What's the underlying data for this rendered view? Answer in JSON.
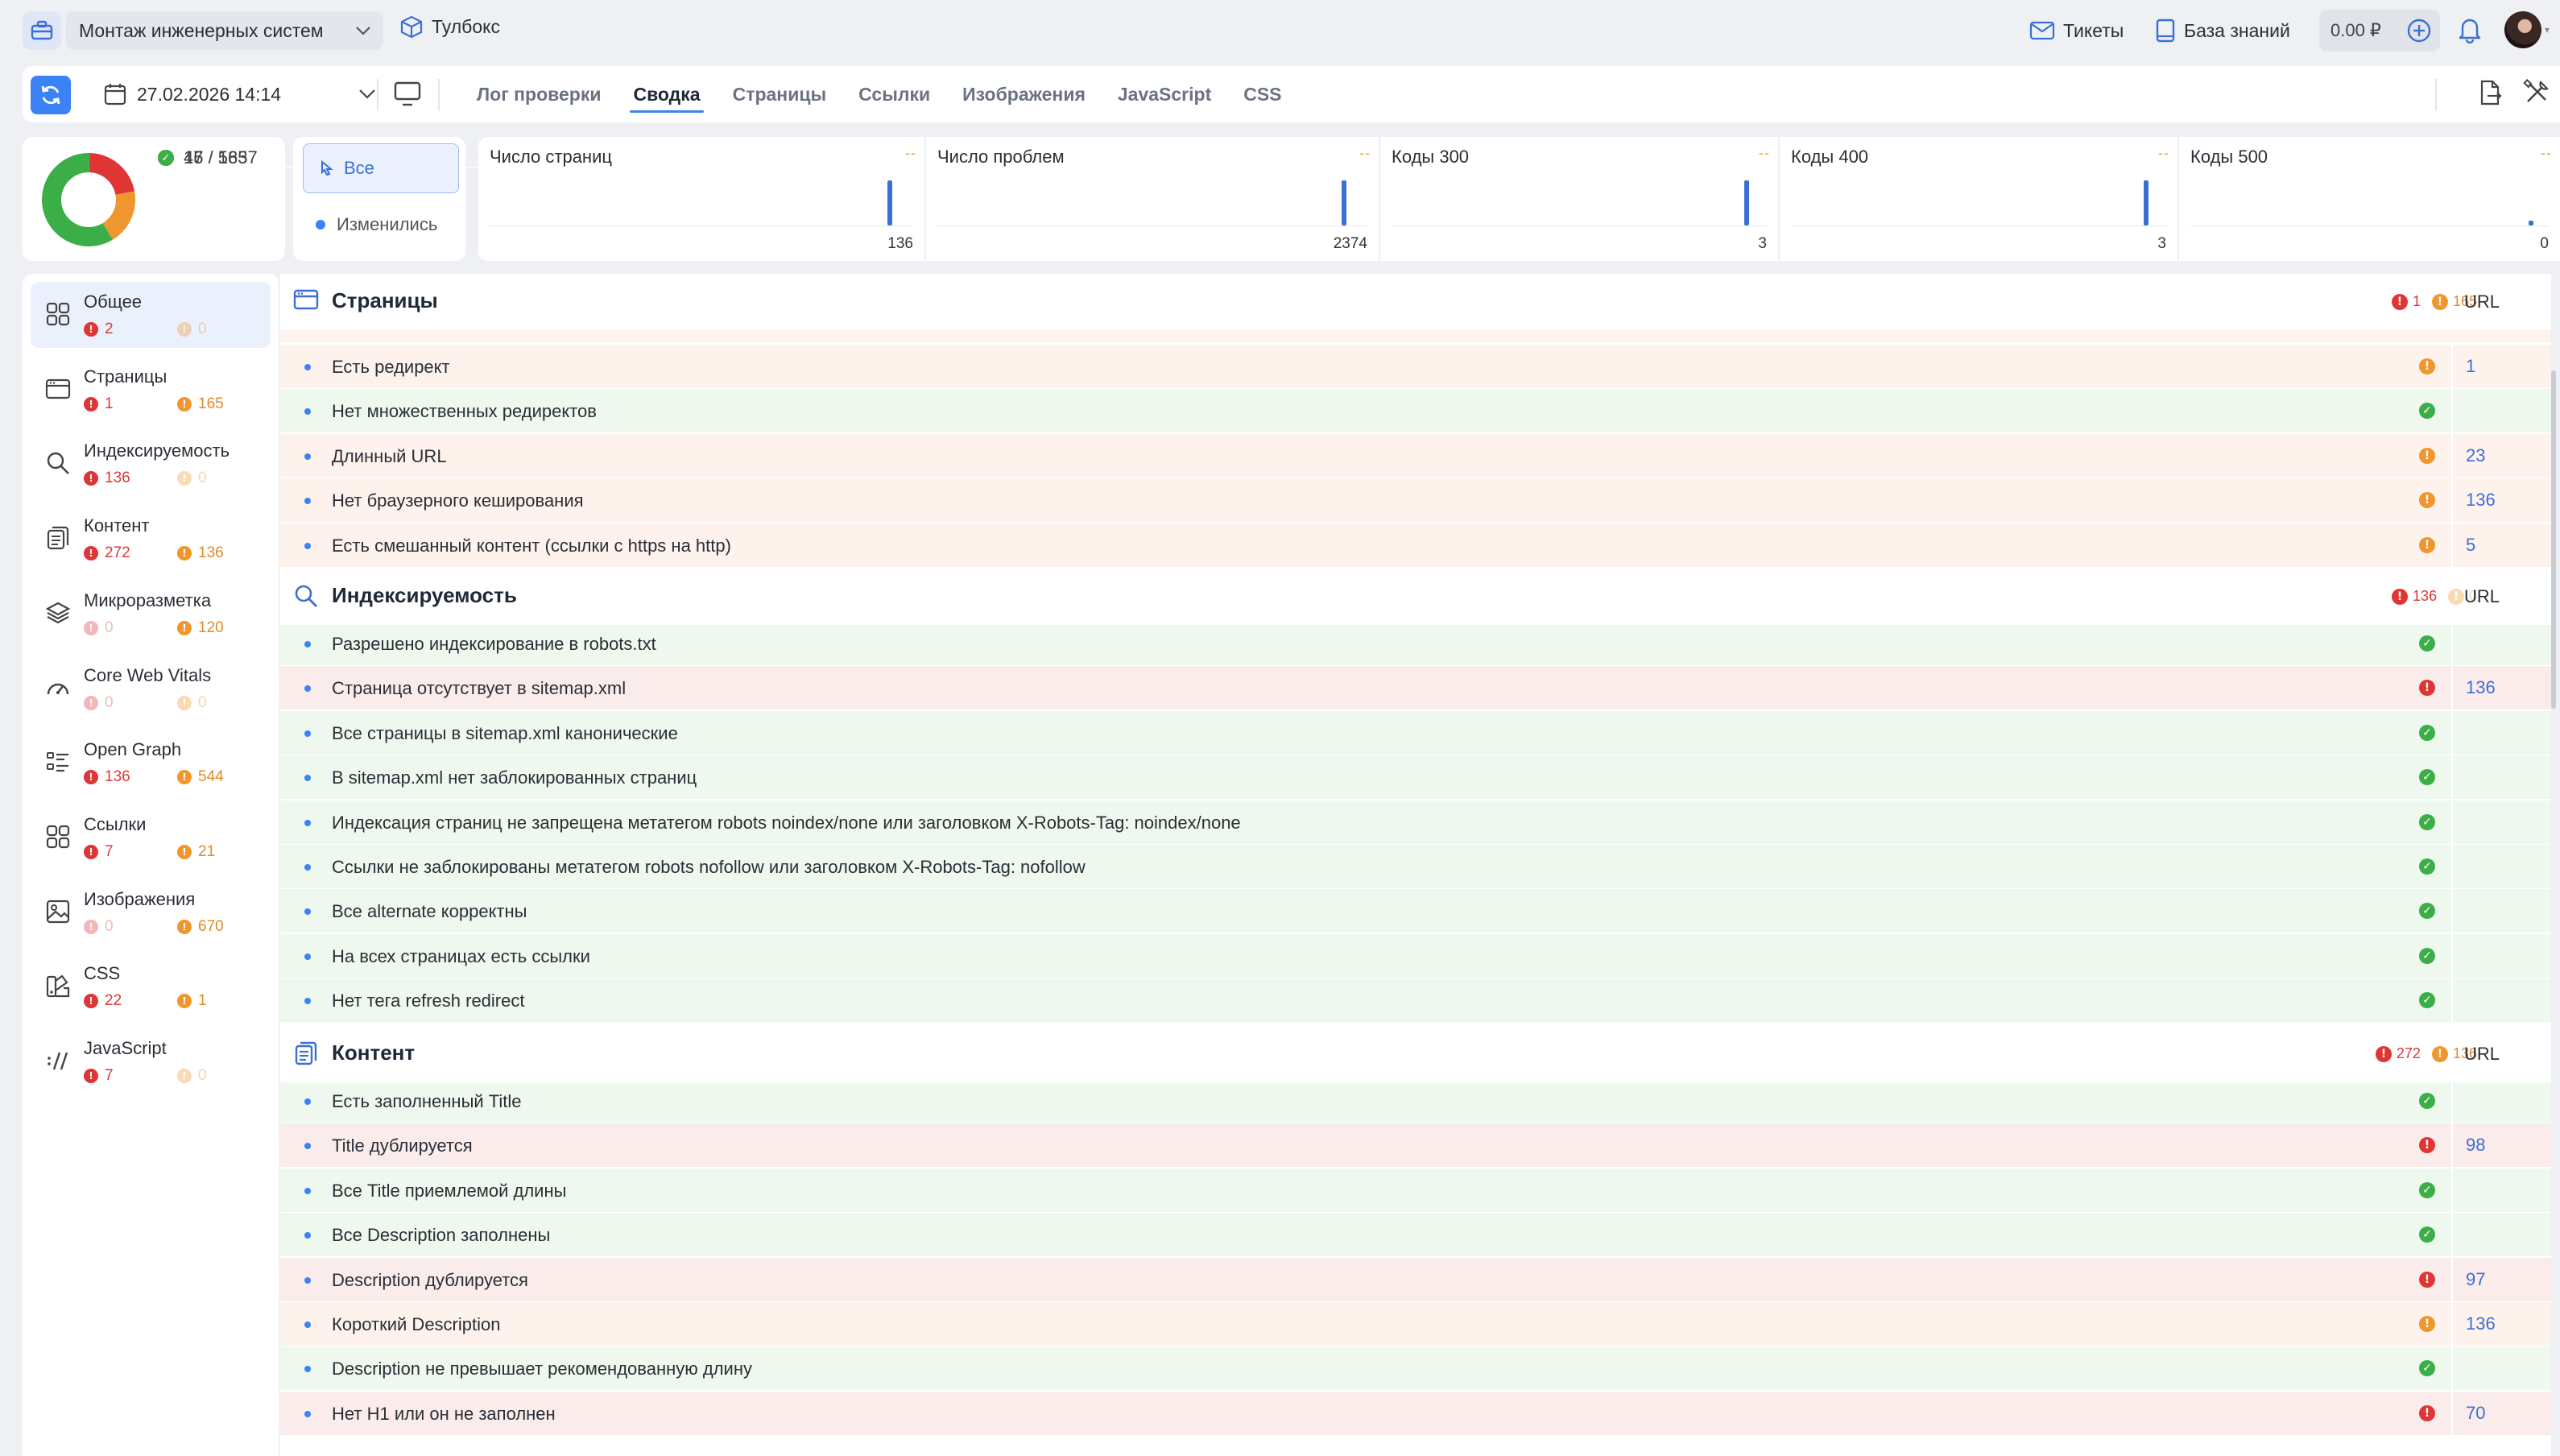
{
  "topbar": {
    "project": "Монтаж инженерных систем",
    "toolbox": "Тулбокс",
    "tickets": "Тикеты",
    "knowledge_base": "База знаний",
    "balance": "0.00 ₽"
  },
  "nav": {
    "date": "27.02.2026 14:14",
    "tabs": [
      "Лог проверки",
      "Сводка",
      "Страницы",
      "Ссылки",
      "Изображения",
      "JavaScript",
      "CSS"
    ],
    "active_tab": "Сводка"
  },
  "summary": {
    "errors": "17 / 583",
    "warnings": "15 / 1657",
    "passed": "46",
    "donut": {
      "errors": 17,
      "warnings": 15,
      "passed": 46,
      "colors": {
        "errors": "#e03535",
        "warnings": "#f0962e",
        "passed": "#3cae48"
      }
    }
  },
  "filter": {
    "all": "Все",
    "changed": "Изменились"
  },
  "metrics": [
    {
      "label": "Число страниц",
      "trend": "--",
      "value": "136"
    },
    {
      "label": "Число проблем",
      "trend": "--",
      "value": "2374"
    },
    {
      "label": "Коды 300",
      "trend": "--",
      "value": "3"
    },
    {
      "label": "Коды 400",
      "trend": "--",
      "value": "3"
    },
    {
      "label": "Коды 500",
      "trend": "--",
      "value": "0"
    }
  ],
  "sidebar": [
    {
      "label": "Общее",
      "err": "2",
      "warn": "0",
      "icon": "grid-icon",
      "active": true
    },
    {
      "label": "Страницы",
      "err": "1",
      "warn": "165",
      "icon": "browser-window-icon"
    },
    {
      "label": "Индексируемость",
      "err": "136",
      "warn": "0",
      "icon": "search-icon"
    },
    {
      "label": "Контент",
      "err": "272",
      "warn": "136",
      "icon": "documents-icon"
    },
    {
      "label": "Микроразметка",
      "err": "0",
      "warn": "120",
      "icon": "layers-icon"
    },
    {
      "label": "Core Web Vitals",
      "err": "0",
      "warn": "0",
      "icon": "gauge-icon"
    },
    {
      "label": "Open Graph",
      "err": "136",
      "warn": "544",
      "icon": "list-icon"
    },
    {
      "label": "Ссылки",
      "err": "7",
      "warn": "21",
      "icon": "grid-icon"
    },
    {
      "label": "Изображения",
      "err": "0",
      "warn": "670",
      "icon": "image-icon"
    },
    {
      "label": "CSS",
      "err": "22",
      "warn": "1",
      "icon": "css-swatch-icon"
    },
    {
      "label": "JavaScript",
      "err": "7",
      "warn": "0",
      "icon": "js-slash-icon"
    }
  ],
  "sections": [
    {
      "title": "Страницы",
      "err": "1",
      "warn": "165",
      "url_label": "URL",
      "rows": [
        {
          "text": "Есть редирект",
          "status": "warn",
          "url": "1"
        },
        {
          "text": "Нет множественных редиректов",
          "status": "ok",
          "url": ""
        },
        {
          "text": "Длинный URL",
          "status": "warn",
          "url": "23"
        },
        {
          "text": "Нет браузерного кеширования",
          "status": "warn",
          "url": "136"
        },
        {
          "text": "Есть смешанный контент (ссылки с https на http)",
          "status": "warn",
          "url": "5"
        }
      ]
    },
    {
      "title": "Индексируемость",
      "err": "136",
      "warn": "0",
      "url_label": "URL",
      "rows": [
        {
          "text": "Разрешено индексирование в robots.txt",
          "status": "ok",
          "url": ""
        },
        {
          "text": "Страница отсутствует в sitemap.xml",
          "status": "err",
          "url": "136"
        },
        {
          "text": "Все страницы в sitemap.xml канонические",
          "status": "ok",
          "url": ""
        },
        {
          "text": "В sitemap.xml нет заблокированных страниц",
          "status": "ok",
          "url": ""
        },
        {
          "text": "Индексация страниц не запрещена метатегом robots noindex/none или заголовком X-Robots-Tag: noindex/none",
          "status": "ok",
          "url": ""
        },
        {
          "text": "Ссылки не заблокированы метатегом robots nofollow или заголовком X-Robots-Tag: nofollow",
          "status": "ok",
          "url": ""
        },
        {
          "text": "Все alternate корректны",
          "status": "ok",
          "url": ""
        },
        {
          "text": "На всех страницах есть ссылки",
          "status": "ok",
          "url": ""
        },
        {
          "text": "Нет тега refresh redirect",
          "status": "ok",
          "url": ""
        }
      ]
    },
    {
      "title": "Контент",
      "err": "272",
      "warn": "136",
      "url_label": "URL",
      "rows": [
        {
          "text": "Есть заполненный Title",
          "status": "ok",
          "url": ""
        },
        {
          "text": "Title дублируется",
          "status": "err",
          "url": "98"
        },
        {
          "text": "Все Title приемлемой длины",
          "status": "ok",
          "url": ""
        },
        {
          "text": "Все Description заполнены",
          "status": "ok",
          "url": ""
        },
        {
          "text": "Description дублируется",
          "status": "err",
          "url": "97"
        },
        {
          "text": "Короткий Description",
          "status": "warn",
          "url": "136"
        },
        {
          "text": "Description не превышает рекомендованную длину",
          "status": "ok",
          "url": ""
        },
        {
          "text": "Нет H1 или он не заполнен",
          "status": "err",
          "url": "70"
        }
      ]
    }
  ]
}
